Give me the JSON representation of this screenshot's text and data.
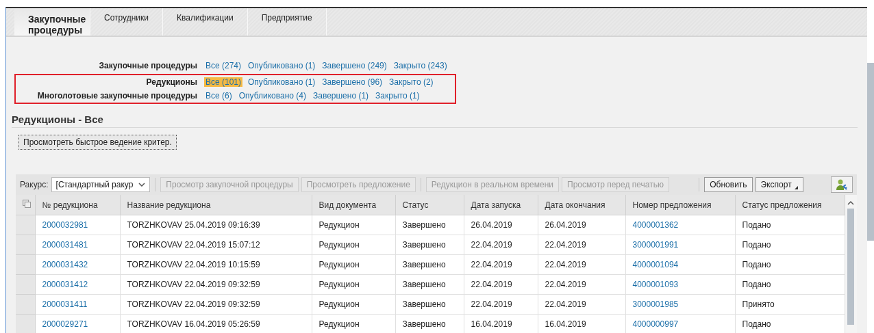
{
  "tabs": [
    {
      "label": "Закупочные процедуры",
      "selected": true
    },
    {
      "label": "Сотрудники",
      "selected": false
    },
    {
      "label": "Квалификации",
      "selected": false
    },
    {
      "label": "Предприятие",
      "selected": false
    }
  ],
  "filters": [
    {
      "label": "Закупочные процедуры",
      "highlighted": false,
      "links": [
        {
          "text": "Все (274)",
          "selected": false
        },
        {
          "text": "Опубликовано (1)",
          "selected": false
        },
        {
          "text": "Завершено (249)",
          "selected": false
        },
        {
          "text": "Закрыто (243)",
          "selected": false
        }
      ]
    },
    {
      "label": "Редукционы",
      "highlighted": true,
      "links": [
        {
          "text": "Все (101)",
          "selected": true
        },
        {
          "text": "Опубликовано (1)",
          "selected": false
        },
        {
          "text": "Завершено (96)",
          "selected": false
        },
        {
          "text": "Закрыто (2)",
          "selected": false
        }
      ]
    },
    {
      "label": "Многолотовые закупочные процедуры",
      "highlighted": true,
      "links": [
        {
          "text": "Все (6)",
          "selected": false
        },
        {
          "text": "Опубликовано (4)",
          "selected": false
        },
        {
          "text": "Завершено (1)",
          "selected": false
        },
        {
          "text": "Закрыто (1)",
          "selected": false
        }
      ]
    }
  ],
  "section_title": "Редукционы - Все",
  "quick_criteria_button": "Просмотреть быстрое ведение критер.",
  "toolbar": {
    "view_label": "Ракурс:",
    "view_value": "[Стандартный ракур",
    "buttons": [
      {
        "label": "Просмотр закупочной процедуры",
        "disabled": true
      },
      {
        "label": "Просмотреть предложение",
        "disabled": true
      },
      {
        "label": "Редукцион в реальном времени",
        "disabled": true
      },
      {
        "label": "Просмотр перед печатью",
        "disabled": true
      },
      {
        "label": "Обновить",
        "disabled": false
      },
      {
        "label": "Экспорт",
        "disabled": false
      }
    ]
  },
  "table": {
    "columns": [
      "№ редукциона",
      "Название редукциона",
      "Вид документа",
      "Статус",
      "Дата запуска",
      "Дата окончания",
      "Номер предложения",
      "Статус предложения"
    ],
    "rows": [
      [
        "2000032981",
        "TORZHKOVAV 25.04.2019 09:16:39",
        "Редукцион",
        "Завершено",
        "26.04.2019",
        "26.04.2019",
        "4000001362",
        "Подано"
      ],
      [
        "2000031481",
        "TORZHKOVAV 22.04.2019 15:07:12",
        "Редукцион",
        "Завершено",
        "22.04.2019",
        "22.04.2019",
        "3000001991",
        "Подано"
      ],
      [
        "2000031432",
        "TORZHKOVAV 22.04.2019 10:15:59",
        "Редукцион",
        "Завершено",
        "22.04.2019",
        "22.04.2019",
        "4000001094",
        "Подано"
      ],
      [
        "2000031412",
        "TORZHKOVAV 22.04.2019 09:32:59",
        "Редукцион",
        "Завершено",
        "22.04.2019",
        "22.04.2019",
        "4000001093",
        "Подано"
      ],
      [
        "2000031411",
        "TORZHKOVAV 22.04.2019 09:32:59",
        "Редукцион",
        "Завершено",
        "22.04.2019",
        "22.04.2019",
        "3000001985",
        "Принято"
      ],
      [
        "2000029271",
        "TORZHKOVAV 16.04.2019 05:26:59",
        "Редукцион",
        "Завершено",
        "16.04.2019",
        "16.04.2019",
        "4000000997",
        "Подано"
      ]
    ]
  }
}
